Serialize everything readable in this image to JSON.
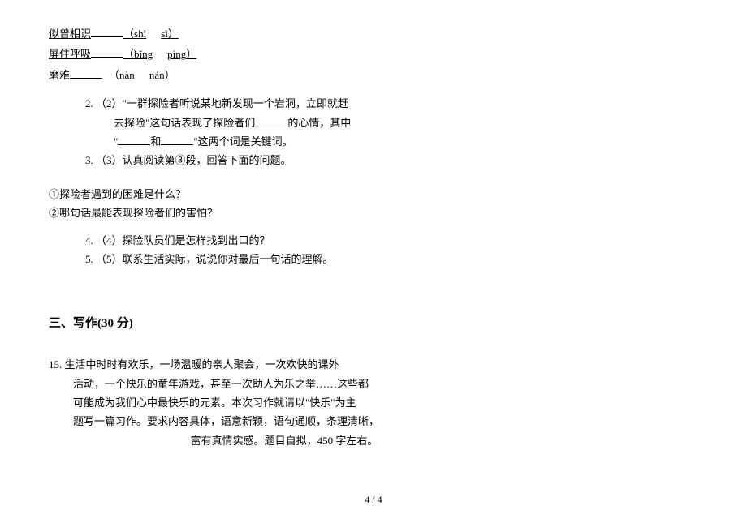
{
  "pinyin": {
    "line1_text": "似曾相识",
    "line1_pinyin_open": "（sh",
    "line1_pinyin_a": "ì",
    "line1_pinyin_b": "sì",
    "line1_pinyin_close": "）",
    "line2_text": "屏住呼吸",
    "line2_pinyin_open": "（b",
    "line2_pinyin_a": "ǐng",
    "line2_pinyin_b": "píng",
    "line2_pinyin_close": "）",
    "line3_text": "磨难",
    "line3_pinyin_open": "（n",
    "line3_pinyin_a": "àn",
    "line3_pinyin_b": "nán",
    "line3_pinyin_close": "）"
  },
  "q2": {
    "num": "2.",
    "label": "（2）",
    "line1a": "\"一群探险者听说某地新发现一个岩洞，立即就赶",
    "line2a": "去探险\"这句话表现了探险者们",
    "line2b": "的心情，其中",
    "line3a": "\"",
    "line3_mid": "和",
    "line3b": "\"这两个词是关键词。"
  },
  "q3": {
    "num": "3.",
    "label": "（3）认真阅读第③段，回答下面的问题。"
  },
  "sub": {
    "s1": "①探险者遇到的困难是什么？",
    "s2": "②哪句话最能表现探险者们的害怕？"
  },
  "q4": {
    "num": "4.",
    "label": "（4）探险队员们是怎样找到出口的？"
  },
  "q5": {
    "num": "5.",
    "label": "（5）联系生活实际，说说你对最后一句话的理解。"
  },
  "section": {
    "heading": "三、写作(30 分)"
  },
  "writing": {
    "num": "15.",
    "l1": "生活中时时有欢乐，一场温暖的亲人聚会，一次欢快的课外",
    "l2": "活动，一个快乐的童年游戏，甚至一次助人为乐之举……这些都",
    "l3": "可能成为我们心中最快乐的元素。本次习作就请以\"快乐\"为主",
    "l4": "题写一篇习作。要求内容具体，语意新颖，语句通顺，条理清晰，",
    "l5": "富有真情实感。题目自拟，450 字左右。"
  },
  "page": {
    "number": "4 / 4"
  }
}
